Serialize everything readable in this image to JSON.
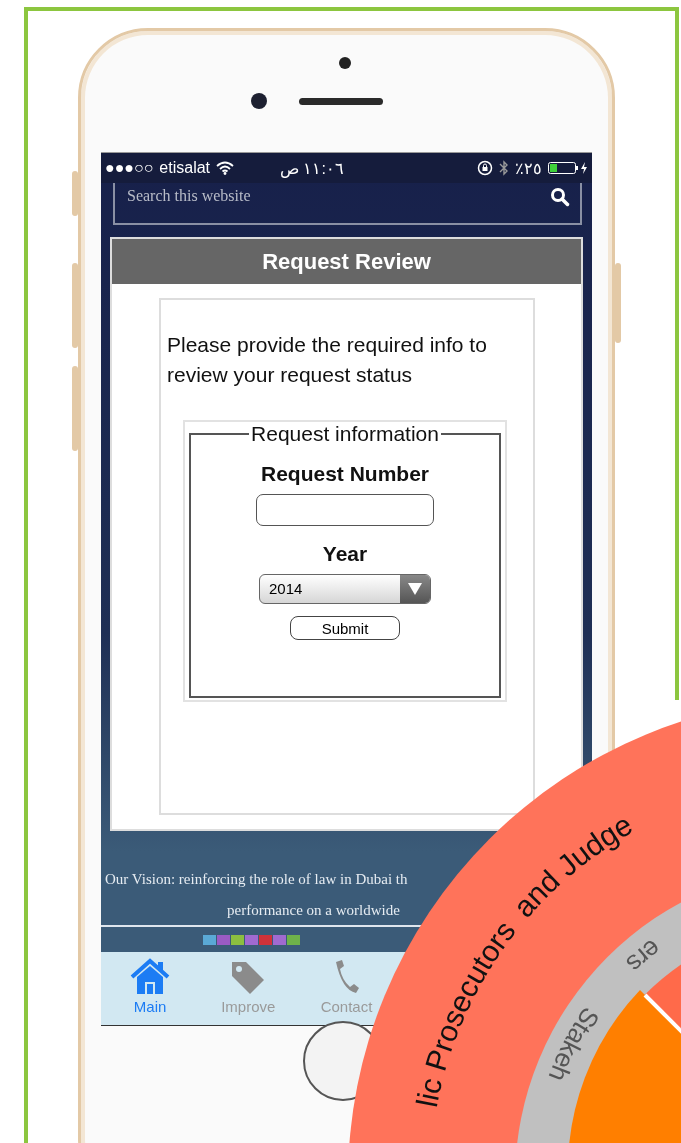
{
  "status_bar": {
    "signal": "●●●○○",
    "carrier": "etisalat",
    "time": "١١:٠٦ ص",
    "battery": "٢٥٪"
  },
  "search": {
    "placeholder": "Search this website"
  },
  "panel": {
    "title": "Request Review",
    "instructions": "Please provide the required info to review your request status",
    "form": {
      "legend": "Request information",
      "fields": [
        {
          "kind": "text",
          "label": "Request Number"
        },
        {
          "kind": "select",
          "label": "Year",
          "value": "2014"
        }
      ],
      "submit": "Submit"
    }
  },
  "footer": {
    "vision_lines": [
      "Our Vision: reinforcing the role of law in Dubai th",
      "performance on a worldwide"
    ]
  },
  "tab_bar": [
    {
      "label": "Main",
      "selected": true
    },
    {
      "label": "Improve",
      "selected": false
    },
    {
      "label": "Contact",
      "selected": false
    }
  ],
  "diagram": {
    "outer_ring_texts": [
      "lic Prosecutors",
      "and Judge"
    ],
    "inner_ring_texts": [
      "Stakeh",
      "ers"
    ]
  }
}
